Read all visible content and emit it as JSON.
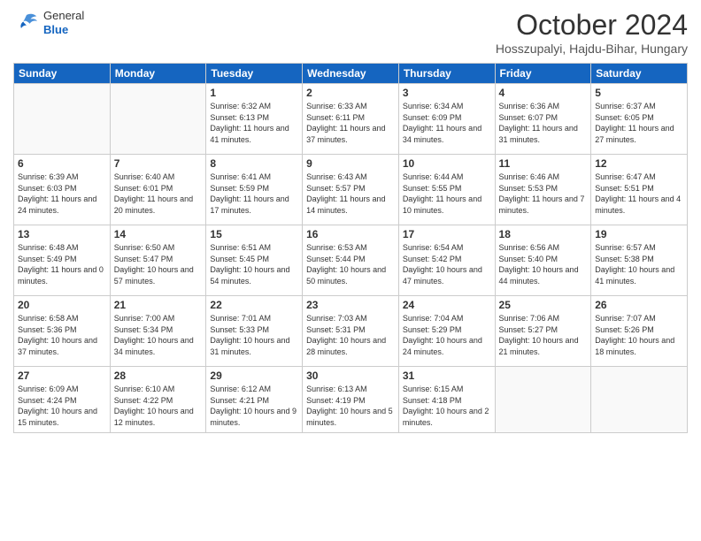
{
  "header": {
    "logo": {
      "general": "General",
      "blue": "Blue"
    },
    "title": "October 2024",
    "location": "Hosszupalyi, Hajdu-Bihar, Hungary"
  },
  "weekdays": [
    "Sunday",
    "Monday",
    "Tuesday",
    "Wednesday",
    "Thursday",
    "Friday",
    "Saturday"
  ],
  "weeks": [
    [
      {
        "day": "",
        "info": ""
      },
      {
        "day": "",
        "info": ""
      },
      {
        "day": "1",
        "info": "Sunrise: 6:32 AM\nSunset: 6:13 PM\nDaylight: 11 hours and 41 minutes."
      },
      {
        "day": "2",
        "info": "Sunrise: 6:33 AM\nSunset: 6:11 PM\nDaylight: 11 hours and 37 minutes."
      },
      {
        "day": "3",
        "info": "Sunrise: 6:34 AM\nSunset: 6:09 PM\nDaylight: 11 hours and 34 minutes."
      },
      {
        "day": "4",
        "info": "Sunrise: 6:36 AM\nSunset: 6:07 PM\nDaylight: 11 hours and 31 minutes."
      },
      {
        "day": "5",
        "info": "Sunrise: 6:37 AM\nSunset: 6:05 PM\nDaylight: 11 hours and 27 minutes."
      }
    ],
    [
      {
        "day": "6",
        "info": "Sunrise: 6:39 AM\nSunset: 6:03 PM\nDaylight: 11 hours and 24 minutes."
      },
      {
        "day": "7",
        "info": "Sunrise: 6:40 AM\nSunset: 6:01 PM\nDaylight: 11 hours and 20 minutes."
      },
      {
        "day": "8",
        "info": "Sunrise: 6:41 AM\nSunset: 5:59 PM\nDaylight: 11 hours and 17 minutes."
      },
      {
        "day": "9",
        "info": "Sunrise: 6:43 AM\nSunset: 5:57 PM\nDaylight: 11 hours and 14 minutes."
      },
      {
        "day": "10",
        "info": "Sunrise: 6:44 AM\nSunset: 5:55 PM\nDaylight: 11 hours and 10 minutes."
      },
      {
        "day": "11",
        "info": "Sunrise: 6:46 AM\nSunset: 5:53 PM\nDaylight: 11 hours and 7 minutes."
      },
      {
        "day": "12",
        "info": "Sunrise: 6:47 AM\nSunset: 5:51 PM\nDaylight: 11 hours and 4 minutes."
      }
    ],
    [
      {
        "day": "13",
        "info": "Sunrise: 6:48 AM\nSunset: 5:49 PM\nDaylight: 11 hours and 0 minutes."
      },
      {
        "day": "14",
        "info": "Sunrise: 6:50 AM\nSunset: 5:47 PM\nDaylight: 10 hours and 57 minutes."
      },
      {
        "day": "15",
        "info": "Sunrise: 6:51 AM\nSunset: 5:45 PM\nDaylight: 10 hours and 54 minutes."
      },
      {
        "day": "16",
        "info": "Sunrise: 6:53 AM\nSunset: 5:44 PM\nDaylight: 10 hours and 50 minutes."
      },
      {
        "day": "17",
        "info": "Sunrise: 6:54 AM\nSunset: 5:42 PM\nDaylight: 10 hours and 47 minutes."
      },
      {
        "day": "18",
        "info": "Sunrise: 6:56 AM\nSunset: 5:40 PM\nDaylight: 10 hours and 44 minutes."
      },
      {
        "day": "19",
        "info": "Sunrise: 6:57 AM\nSunset: 5:38 PM\nDaylight: 10 hours and 41 minutes."
      }
    ],
    [
      {
        "day": "20",
        "info": "Sunrise: 6:58 AM\nSunset: 5:36 PM\nDaylight: 10 hours and 37 minutes."
      },
      {
        "day": "21",
        "info": "Sunrise: 7:00 AM\nSunset: 5:34 PM\nDaylight: 10 hours and 34 minutes."
      },
      {
        "day": "22",
        "info": "Sunrise: 7:01 AM\nSunset: 5:33 PM\nDaylight: 10 hours and 31 minutes."
      },
      {
        "day": "23",
        "info": "Sunrise: 7:03 AM\nSunset: 5:31 PM\nDaylight: 10 hours and 28 minutes."
      },
      {
        "day": "24",
        "info": "Sunrise: 7:04 AM\nSunset: 5:29 PM\nDaylight: 10 hours and 24 minutes."
      },
      {
        "day": "25",
        "info": "Sunrise: 7:06 AM\nSunset: 5:27 PM\nDaylight: 10 hours and 21 minutes."
      },
      {
        "day": "26",
        "info": "Sunrise: 7:07 AM\nSunset: 5:26 PM\nDaylight: 10 hours and 18 minutes."
      }
    ],
    [
      {
        "day": "27",
        "info": "Sunrise: 6:09 AM\nSunset: 4:24 PM\nDaylight: 10 hours and 15 minutes."
      },
      {
        "day": "28",
        "info": "Sunrise: 6:10 AM\nSunset: 4:22 PM\nDaylight: 10 hours and 12 minutes."
      },
      {
        "day": "29",
        "info": "Sunrise: 6:12 AM\nSunset: 4:21 PM\nDaylight: 10 hours and 9 minutes."
      },
      {
        "day": "30",
        "info": "Sunrise: 6:13 AM\nSunset: 4:19 PM\nDaylight: 10 hours and 5 minutes."
      },
      {
        "day": "31",
        "info": "Sunrise: 6:15 AM\nSunset: 4:18 PM\nDaylight: 10 hours and 2 minutes."
      },
      {
        "day": "",
        "info": ""
      },
      {
        "day": "",
        "info": ""
      }
    ]
  ]
}
